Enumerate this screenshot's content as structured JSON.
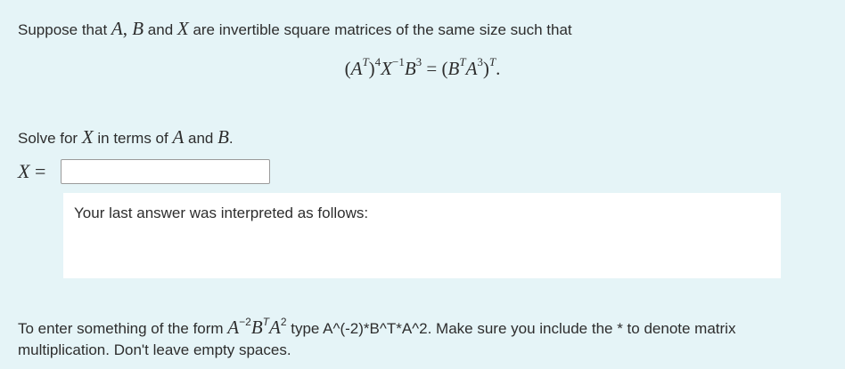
{
  "intro": {
    "text_1": "Suppose that ",
    "var_a": "A",
    "comma": ", ",
    "var_b": "B",
    "text_and": " and ",
    "var_x": "X",
    "text_2": " are invertible square matrices of the same size such that"
  },
  "equation": {
    "lhs_open": "(",
    "lhs_a": "A",
    "lhs_a_sup": "T",
    "lhs_close": ")",
    "lhs_close_sup": "4",
    "lhs_x": "X",
    "lhs_x_sup": "−1",
    "lhs_b": "B",
    "lhs_b_sup": "3",
    "equals": " = ",
    "rhs_open": "(",
    "rhs_b": "B",
    "rhs_b_sup": "T",
    "rhs_a": "A",
    "rhs_a_sup": "3",
    "rhs_close": ")",
    "rhs_close_sup": "T",
    "period": "."
  },
  "solve": {
    "text_1": "Solve for ",
    "var_x": "X",
    "text_2": " in terms of ",
    "var_a": "A",
    "text_3": " and ",
    "var_b": "B",
    "text_4": "."
  },
  "answer": {
    "label_var": "X",
    "label_equals": " =",
    "value": ""
  },
  "interpreted": {
    "text": "Your last answer was interpreted as follows:"
  },
  "hint": {
    "text_1": "To enter something of the form ",
    "a": "A",
    "a_sup": "−2",
    "b": "B",
    "b_sup": "T",
    "a2": "A",
    "a2_sup": "2",
    "text_2": " type A^(-2)*B^T*A^2. Make sure you include the * to denote matrix multiplication. Don't leave empty spaces."
  }
}
